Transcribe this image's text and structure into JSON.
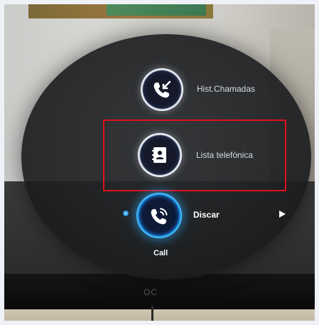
{
  "menu": {
    "items": [
      {
        "label": "Hist.Chamadas",
        "icon": "call-history-icon"
      },
      {
        "label": "Lista telefónica",
        "icon": "phonebook-icon"
      },
      {
        "label": "Discar",
        "icon": "dial-icon"
      }
    ],
    "footer_label": "Call"
  },
  "tv": {
    "brand": "OC"
  },
  "colors": {
    "highlight": "#e0101c",
    "accent_blue": "#1ea2f0",
    "menu_background": "#1c1e20"
  }
}
